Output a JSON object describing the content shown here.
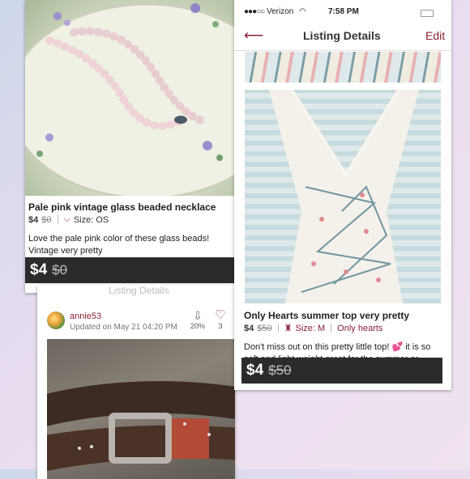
{
  "colors": {
    "accent": "#8a2037",
    "price_bar": "#2c2a2d"
  },
  "card_necklace": {
    "title": "Pale pink vintage glass beaded necklace",
    "price": "$4",
    "original_price": "$0",
    "size": "Size: OS",
    "description": "Love the pale pink color of these glass beads! Vintage very pretty",
    "bar_price": "$4",
    "bar_original_price": "$0"
  },
  "card_top": {
    "status_bar": {
      "carrier": "Verizon",
      "time": "7:58 PM"
    },
    "nav": {
      "title": "Listing Details",
      "edit": "Edit"
    },
    "title": "Only Hearts summer top very pretty",
    "price": "$4",
    "original_price": "$50",
    "size": "Size: M",
    "brand": "Only hearts",
    "description": "Don't miss out on this pretty little top! 💕 it is so soft and light weight great for the summer or",
    "bar_price": "$4",
    "bar_original_price": "$50"
  },
  "card_belt": {
    "hidden_header": "Listing Details",
    "username": "annie53",
    "updated": "Updated on May 21 04:20 PM",
    "share_pct": "20%",
    "likes": "3"
  }
}
